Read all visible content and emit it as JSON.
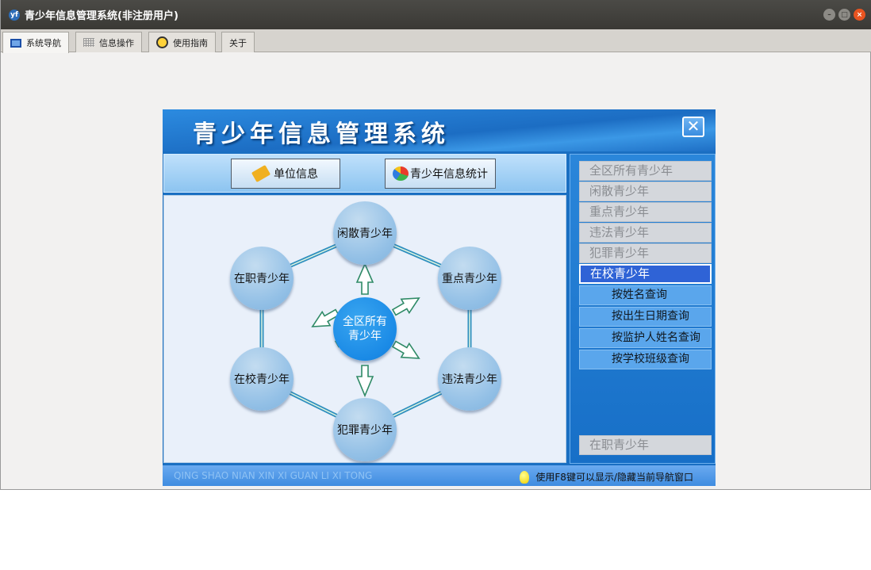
{
  "window": {
    "title": "青少年信息管理系统(非注册用户)",
    "app_icon": "yf"
  },
  "tabs": [
    {
      "label": "系统导航",
      "icon": "monitor-icon"
    },
    {
      "label": "信息操作",
      "icon": "grid-icon"
    },
    {
      "label": "使用指南",
      "icon": "circle-icon"
    },
    {
      "label": "关于"
    }
  ],
  "panel": {
    "title": "青少年信息管理系统",
    "close_glyph": "✕",
    "toolbar": {
      "unit_info": "单位信息",
      "youth_stats": "青少年信息统计"
    },
    "diagram": {
      "center_line1": "全区所有",
      "center_line2": "青少年",
      "nodes": {
        "top": "闲散青少年",
        "top_left": "在职青少年",
        "top_right": "重点青少年",
        "bottom_left": "在校青少年",
        "bottom_right": "违法青少年",
        "bottom": "犯罪青少年"
      }
    },
    "sidebar": {
      "items": [
        "全区所有青少年",
        "闲散青少年",
        "重点青少年",
        "违法青少年",
        "犯罪青少年"
      ],
      "active": "在校青少年",
      "sub_items": [
        "按姓名查询",
        "按出生日期查询",
        "按监护人姓名查询",
        "按学校班级查询"
      ],
      "bottom_item": "在职青少年"
    },
    "footer": {
      "brand": "QING SHAO NIAN XIN XI GUAN LI XI TONG",
      "tip": "使用F8键可以显示/隐藏当前导航窗口"
    }
  },
  "colors": {
    "title_bar": "#3c3b37",
    "panel_blue": "#1a6fc2",
    "sidebar_active": "#2f63d6",
    "close_button": "#e95420"
  }
}
